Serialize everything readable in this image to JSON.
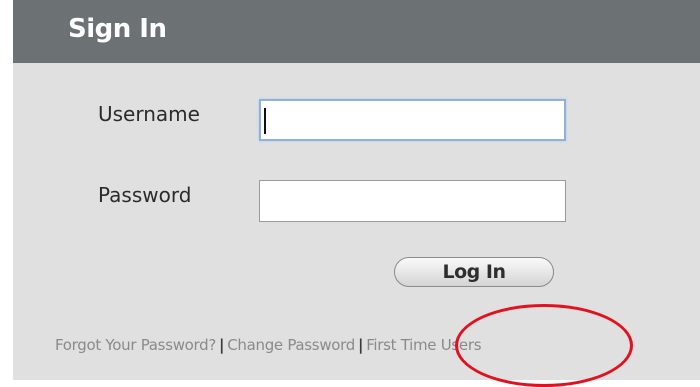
{
  "header": {
    "title": "Sign In"
  },
  "form": {
    "username_label": "Username",
    "username_value": "",
    "password_label": "Password",
    "password_value": "",
    "login_label": "Log In"
  },
  "links": {
    "forgot": "Forgot Your Password?",
    "change": "Change Password",
    "first_time": "First Time Users",
    "separator": "|"
  },
  "colors": {
    "header_bg": "#6c7273",
    "panel_bg": "#dfe0df",
    "annotation": "#e3101e",
    "focus_border": "#8fb1da"
  }
}
